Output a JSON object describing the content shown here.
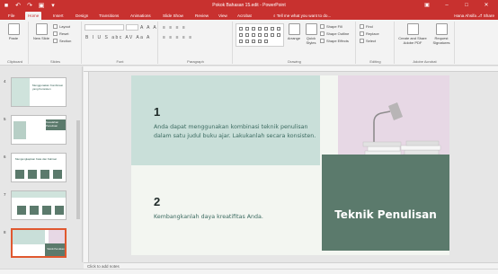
{
  "titlebar": {
    "doc_title": "Pokok Bahasan 15.edit - PowerPoint",
    "qat_icons": [
      "save-icon",
      "undo-icon",
      "redo-icon",
      "start-presentation-icon",
      "customize-icon"
    ],
    "qat_glyphs": [
      "■",
      "↶",
      "↷",
      "▣",
      "▾"
    ],
    "controls": [
      "▣",
      "–",
      "□",
      "✕"
    ]
  },
  "tabs": [
    {
      "label": "File"
    },
    {
      "label": "Home"
    },
    {
      "label": "Insert"
    },
    {
      "label": "Design"
    },
    {
      "label": "Transitions"
    },
    {
      "label": "Animations"
    },
    {
      "label": "Slide Show"
    },
    {
      "label": "Review"
    },
    {
      "label": "View"
    },
    {
      "label": "Acrobat"
    }
  ],
  "tellme": "⌕ Tell me what you want to do...",
  "user": "Hana Ahsifa",
  "share": "⎇ Share",
  "ribbon": {
    "clipboard": {
      "paste": "Paste",
      "label": "Clipboard"
    },
    "slides": {
      "new_slide": "New Slide",
      "layout": "Layout",
      "reset": "Reset",
      "section": "Section",
      "label": "Slides"
    },
    "font": {
      "label": "Font",
      "row1": "A A A",
      "row2": "B I U S abc AV Aa A"
    },
    "paragraph": {
      "label": "Paragraph",
      "row1": "≡ ≡ ≡ ≡",
      "row2": "≡ ≡ ≡ ≡ ≡"
    },
    "drawing": {
      "label": "Drawing",
      "arrange": "Arrange",
      "quick_styles": "Quick Styles",
      "shape_fill": "Shape Fill",
      "shape_outline": "Shape Outline",
      "shape_effects": "Shape Effects"
    },
    "editing": {
      "label": "Editing",
      "find": "Find",
      "replace": "Replace",
      "select": "Select"
    },
    "acrobat": {
      "label": "Adobe Acrobat",
      "create_share": "Create and Share Adobe PDF",
      "request_sig": "Request Signatures"
    }
  },
  "thumbnails": [
    {
      "num": "4",
      "title": "Menggunakan Kombinasi yang Konsisten"
    },
    {
      "num": "5",
      "title": "Kesalahan Penulisan"
    },
    {
      "num": "6",
      "title": "Mengungkapkan Kata dan Kalimat"
    },
    {
      "num": "7",
      "title": ""
    },
    {
      "num": "8",
      "title": "Teknik Penulisan"
    }
  ],
  "slide": {
    "num1": "1",
    "text1": "Anda dapat menggunakan kombinasi teknik penulisan dalam satu judul buku ajar.  Lakukanlah secara konsisten.",
    "num2": "2",
    "text2": "Kembangkanlah daya kreatifitas Anda.",
    "title": "Teknik Penulisan"
  },
  "notes": "Click to add notes",
  "colors": {
    "accent": "#c8312f",
    "slide_teal": "#c9dfd9",
    "slide_green": "#5b7a6c",
    "slide_photo": "#e7d8e5"
  }
}
